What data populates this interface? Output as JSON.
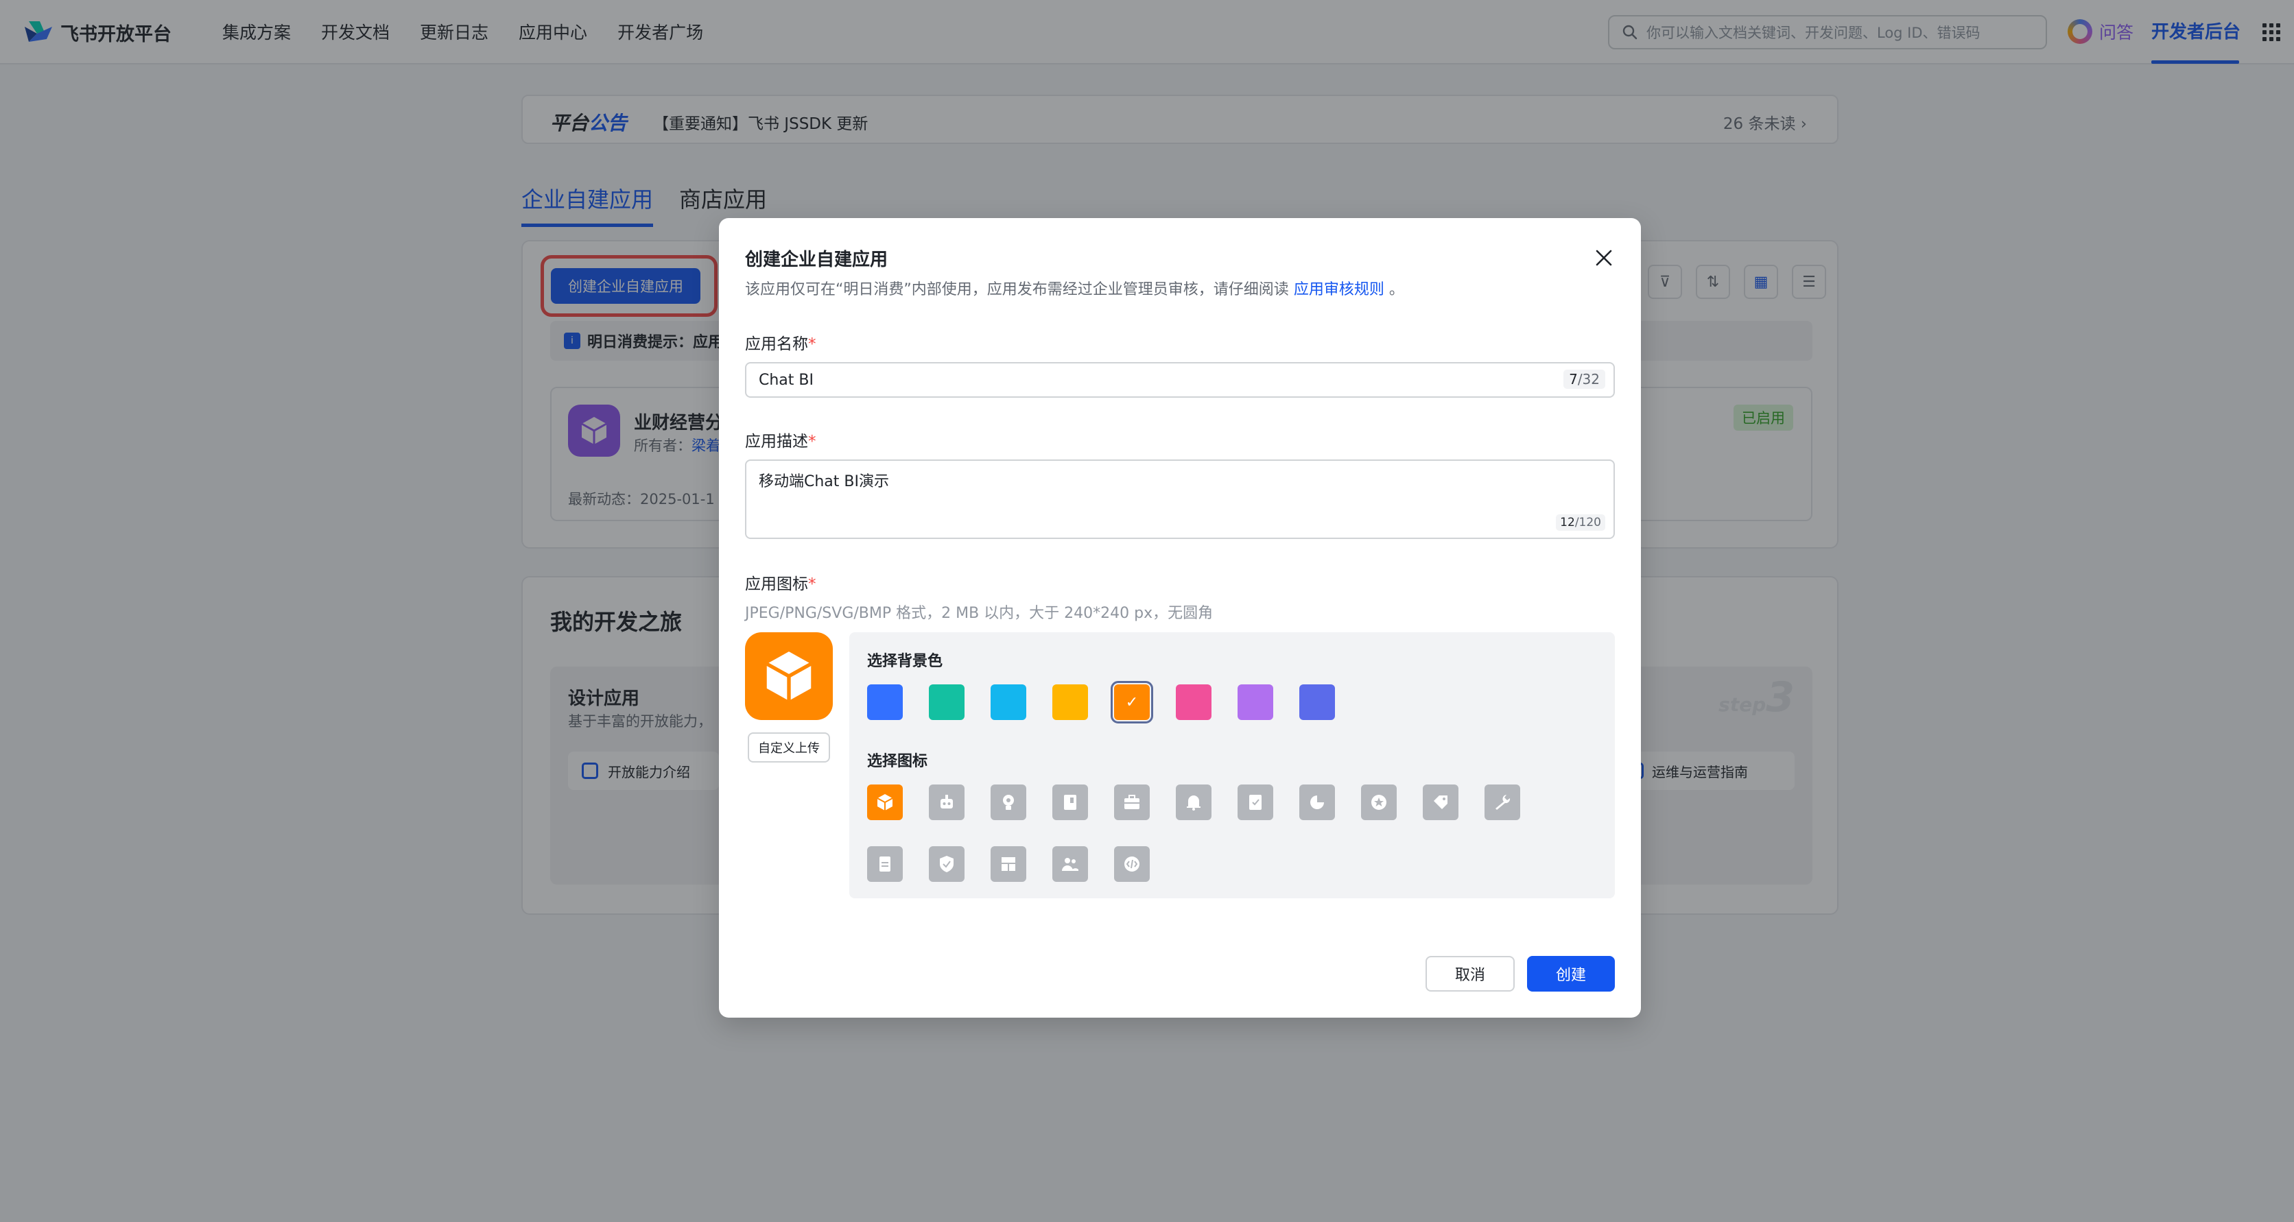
{
  "header": {
    "logo_text": "飞书开放平台",
    "nav": [
      "集成方案",
      "开发文档",
      "更新日志",
      "应用中心",
      "开发者广场"
    ],
    "search_placeholder": "你可以输入文档关键词、开发问题、Log ID、错误码",
    "qa_label": "问答",
    "dev_console_label": "开发者后台"
  },
  "notice": {
    "title_prefix": "平台",
    "title_suffix": "公告",
    "text": "【重要通知】飞书 JSSDK 更新",
    "unread": "26 条未读 ›"
  },
  "tabs": [
    "企业自建应用",
    "商店应用"
  ],
  "apps": {
    "create_button": "创建企业自建应用",
    "consume_tip": "明日消费提示：应用",
    "item": {
      "name": "业财经营分",
      "owner_label": "所有者：",
      "owner_name": "梁着",
      "update": "最新动态：2025-01-1",
      "status": "已启用"
    }
  },
  "journey": {
    "title": "我的开发之旅",
    "design_title": "设计应用",
    "design_desc": "基于丰富的开放能力，",
    "intro_link": "开放能力介绍",
    "step_word": "step",
    "step_num": "3",
    "ops_link": "运维与运营指南"
  },
  "modal": {
    "title": "创建企业自建应用",
    "subtitle": "该应用仅可在“明日消费”内部使用，应用发布需经过企业管理员审核，请仔细阅读",
    "subtitle_link": "应用审核规则",
    "subtitle_end": "。",
    "name_label": "应用名称",
    "name_value": "Chat BI",
    "name_count": "7",
    "name_max": "/32",
    "desc_label": "应用描述",
    "desc_value": "移动端Chat BI演示",
    "desc_count": "12",
    "desc_max": "/120",
    "icon_label": "应用图标",
    "icon_hint": "JPEG/PNG/SVG/BMP 格式，2 MB 以内，大于 240*240 px，无圆角",
    "upload_label": "自定义上传",
    "bg_label": "选择背景色",
    "bg_colors": [
      "#3370ff",
      "#14c0a1",
      "#14b6ee",
      "#ffb500",
      "#ff8800",
      "#f0509a",
      "#b070ef",
      "#5b6bea"
    ],
    "bg_selected_index": 4,
    "icon_pick_label": "选择图标",
    "icons": [
      "box-icon",
      "robot-icon",
      "bulb-icon",
      "book-icon",
      "briefcase-icon",
      "bell-icon",
      "bookmark-icon",
      "pie-icon",
      "star-icon",
      "tag-icon",
      "wrench-icon",
      "document-icon",
      "shield-icon",
      "layout-icon",
      "users-icon",
      "code-icon"
    ],
    "icon_selected_index": 0,
    "cancel": "取消",
    "create": "创建",
    "required_mark": "*"
  }
}
